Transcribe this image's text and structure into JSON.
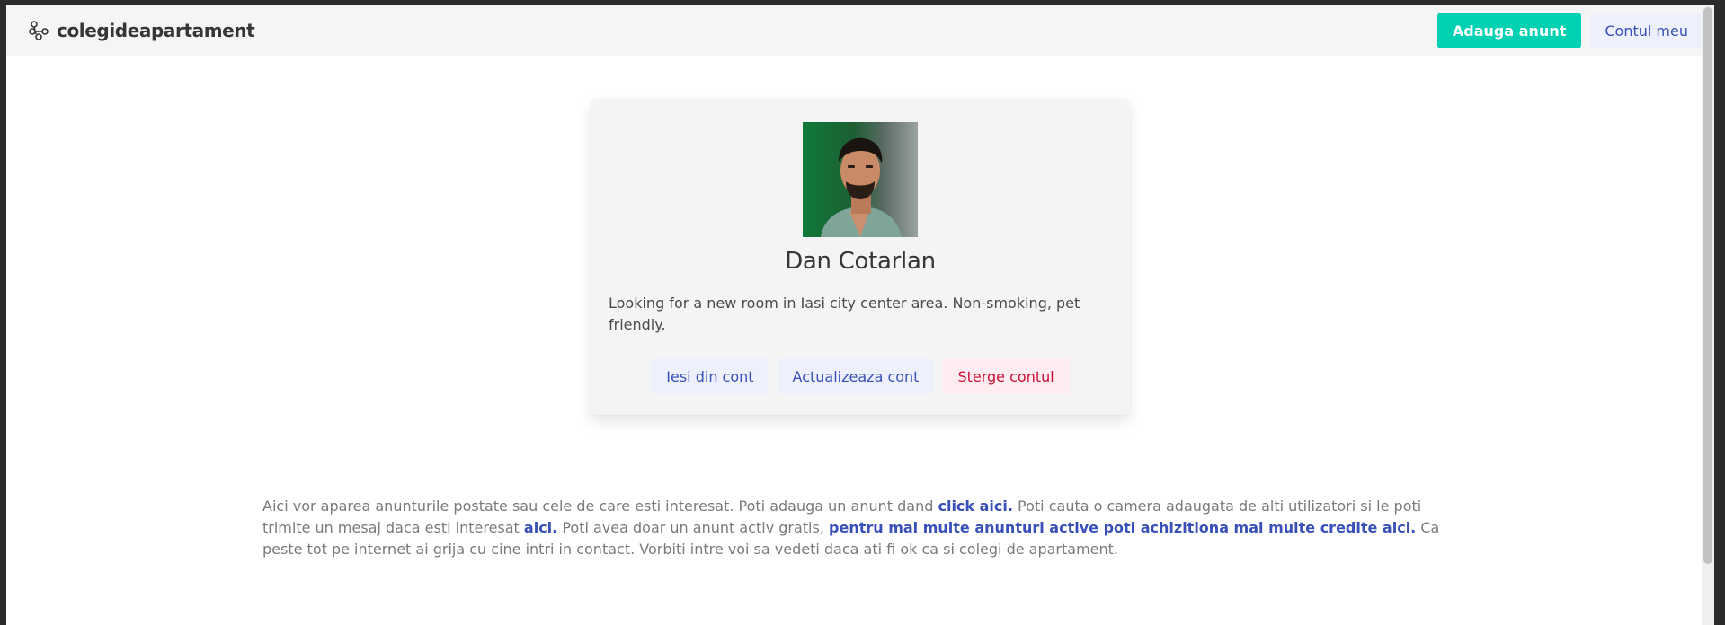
{
  "navbar": {
    "brand_icon": "nodes-icon",
    "brand_name": "colegideapartament",
    "add_listing_label": "Adauga anunt",
    "my_account_label": "Contul meu"
  },
  "profile": {
    "avatar_icon": "profile-photo",
    "name": "Dan Cotarlan",
    "bio": "Looking for a new room in Iasi city center area. Non-smoking, pet friendly.",
    "logout_label": "Iesi din cont",
    "update_label": "Actualizeaza cont",
    "delete_label": "Sterge contul"
  },
  "info": {
    "part1": "Aici vor aparea anunturile postate sau cele de care esti interesat. Poti adauga un anunt dand ",
    "link1": "click aici.",
    "part2": " Poti cauta o camera adaugata de alti utilizatori si le poti trimite un mesaj daca esti interesat ",
    "link2": "aici.",
    "part3": " Poti avea doar un anunt activ gratis, ",
    "link3": "pentru mai multe anunturi active poti achizitiona mai multe credite aici.",
    "part4": " Ca peste tot pe internet ai grija cu cine intri in contact. Vorbiti intre voi sa vedeti daca ati fi ok ca si colegi de apartament."
  },
  "colors": {
    "primary": "#00d1b2",
    "link": "#3850b7",
    "danger": "#cc0f35"
  }
}
